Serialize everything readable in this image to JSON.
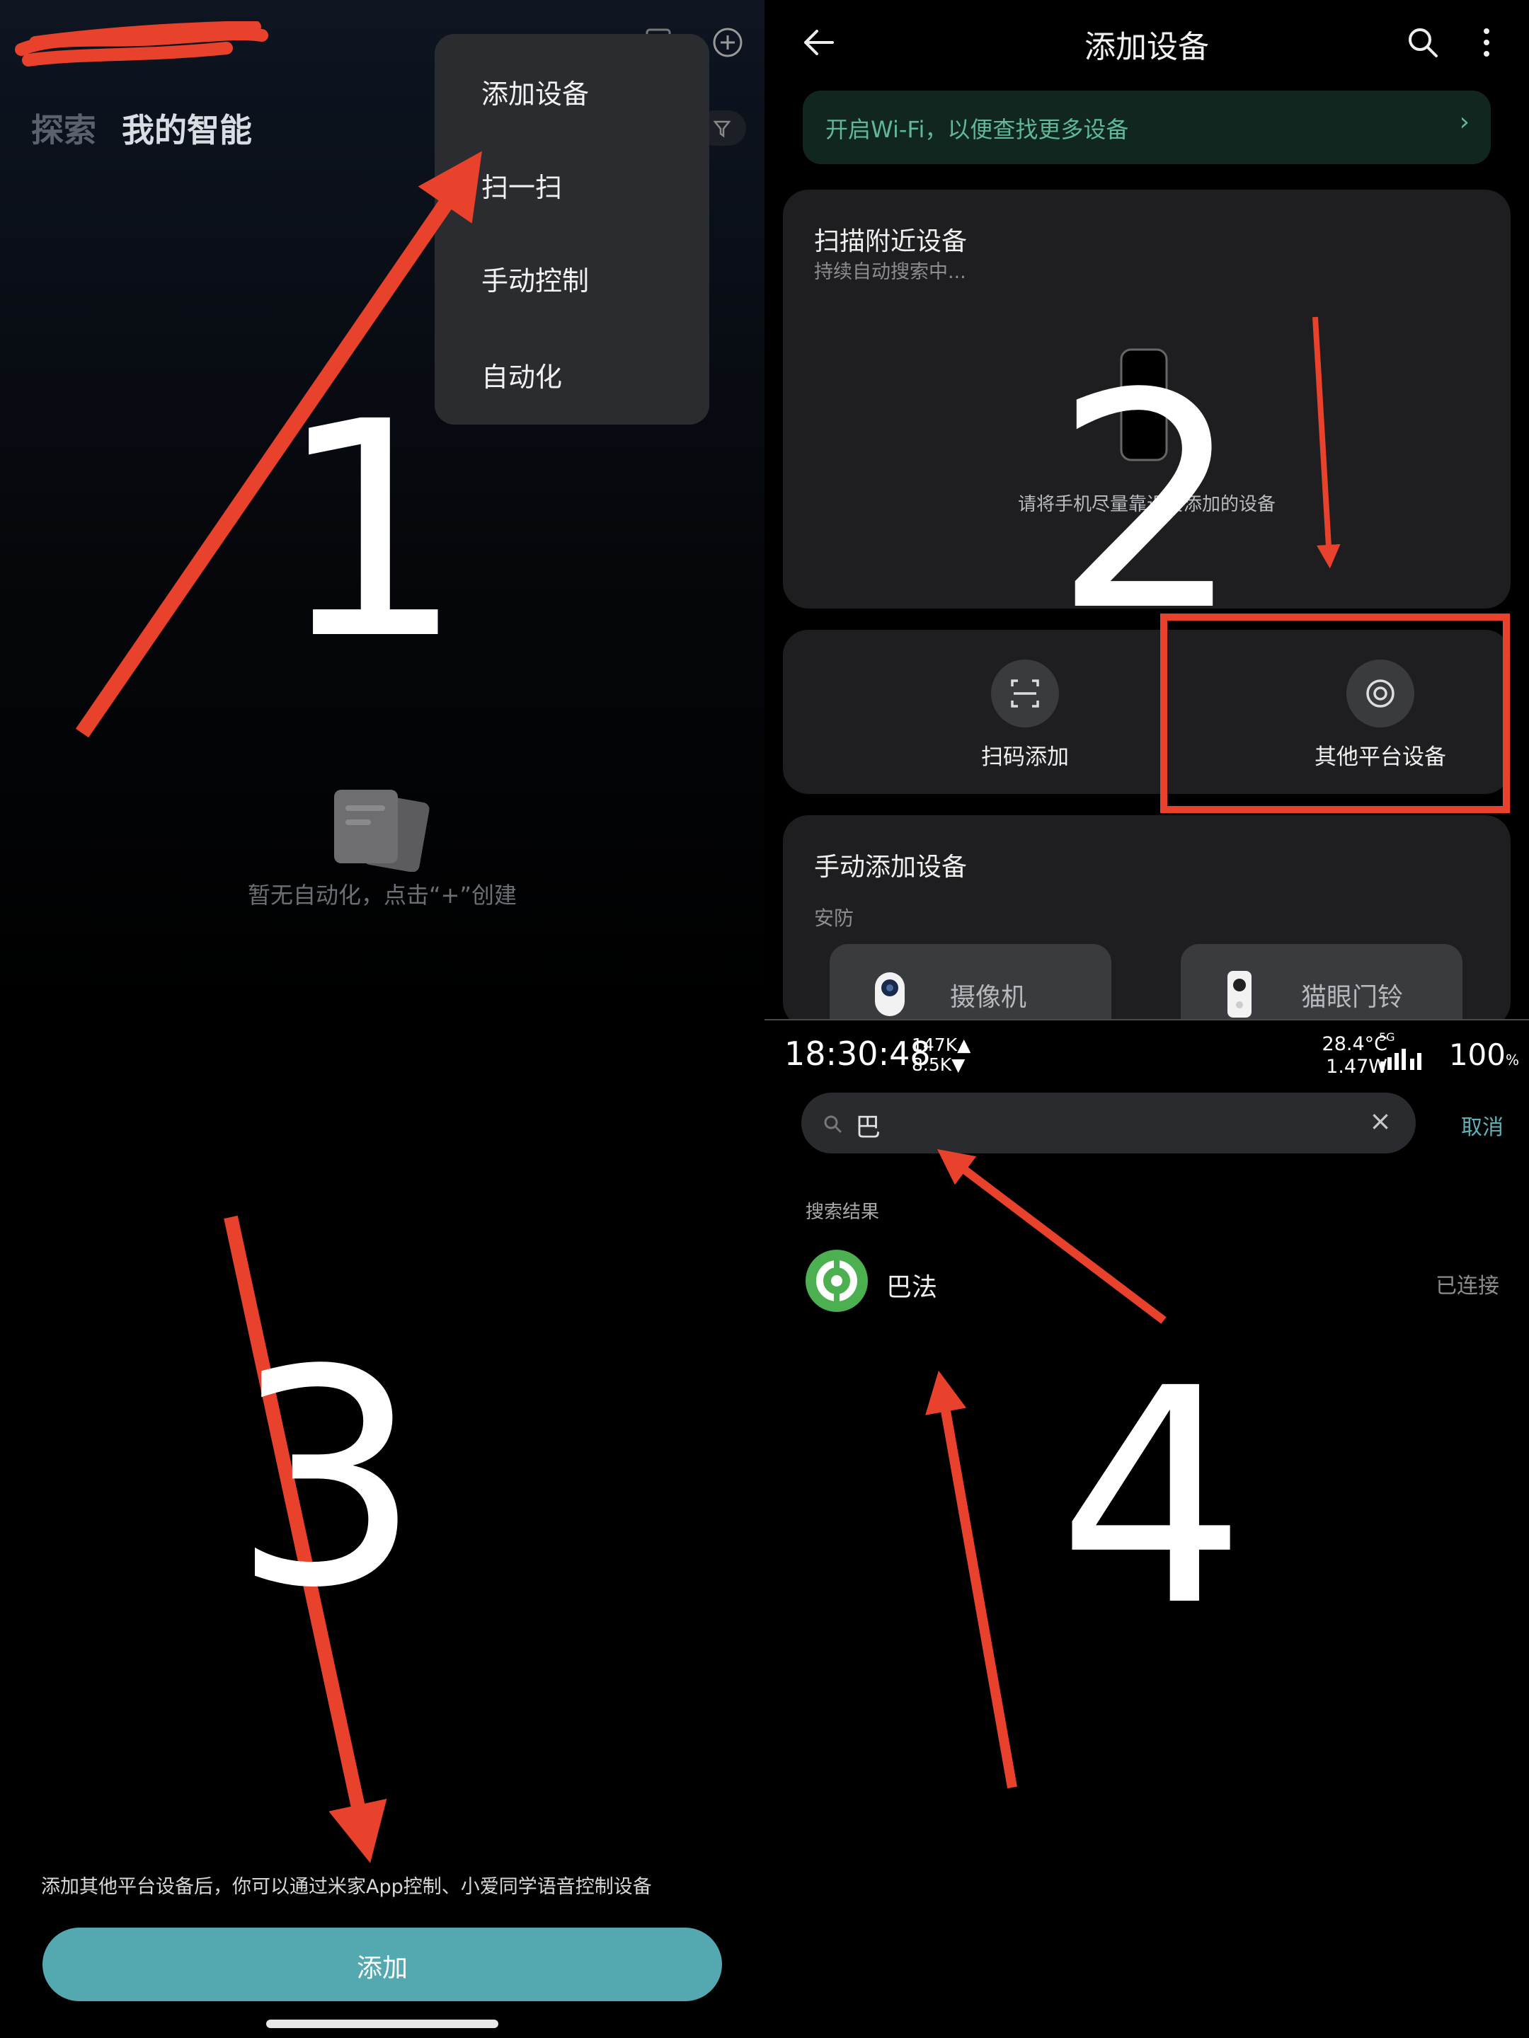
{
  "panel1": {
    "tabs": [
      "探索",
      "我的智能"
    ],
    "menu": [
      "添加设备",
      "扫一扫",
      "手动控制",
      "自动化"
    ],
    "empty_text": "暂无自动化，点击“+”创建",
    "step_number": "1"
  },
  "panel2": {
    "title": "添加设备",
    "wifi_banner": "开启Wi-Fi，以便查找更多设备",
    "wifi_arrow": "›",
    "scan_title": "扫描附近设备",
    "scan_subtitle": "持续自动搜索中...",
    "scan_hint": "请将手机尽量靠近要添加的设备",
    "quick_actions": [
      "扫码添加",
      "其他平台设备"
    ],
    "manual_title": "手动添加设备",
    "manual_category": "安防",
    "manual_devices": [
      "摄像机",
      "猫眼门铃"
    ],
    "step_number": "2"
  },
  "panel3": {
    "description": "添加其他平台设备后，你可以通过米家App控制、小爱同学语音控制设备",
    "button": "添加",
    "step_number": "3"
  },
  "panel4": {
    "status": {
      "time": "18:30:48",
      "up": "147K▲",
      "down": "8.5K▼",
      "temp": "28.4°C",
      "power": "1.47W",
      "network": "5G",
      "battery": "100",
      "battery_unit": "%"
    },
    "search_value": "巴",
    "clear_icon": "×",
    "cancel": "取消",
    "results_label": "搜索结果",
    "result_name": "巴法",
    "result_status": "已连接",
    "step_number": "4"
  },
  "colors": {
    "accent_teal": "#54a9b0",
    "arrow_red": "#e8412c",
    "highlight_red": "#e8412c",
    "result_logo_green": "#4caf50"
  }
}
